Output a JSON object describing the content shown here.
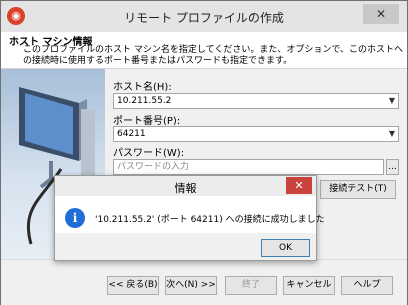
{
  "window": {
    "title": "リモート プロファイルの作成",
    "close_glyph": "✕"
  },
  "header": {
    "title": "ホスト マシン情報",
    "description": "このプロファイルのホスト マシン名を指定してください。また、オプションで、このホストへの接続時に使用するポート番号またはパスワードも指定できます。"
  },
  "form": {
    "host_label": "ホスト名(H):",
    "host_value": "10.211.55.2",
    "port_label": "ポート番号(P):",
    "port_value": "64211",
    "password_label": "パスワード(W):",
    "password_placeholder": "パスワードの入力",
    "browse_label": "...",
    "test_button": "接続テスト(T)"
  },
  "footer": {
    "back": "<< 戻る(B)",
    "next": "次へ(N) >>",
    "finish": "終了",
    "cancel": "キャンセル",
    "help": "ヘルプ"
  },
  "dialog": {
    "title": "情報",
    "message": "'10.211.55.2' (ポート 64211) への接続に成功しました",
    "ok": "OK",
    "icon_glyph": "i",
    "close_glyph": "✕"
  },
  "icons": {
    "app": "app-logo-icon",
    "info": "info-icon",
    "dropdown": "chevron-down-icon"
  }
}
